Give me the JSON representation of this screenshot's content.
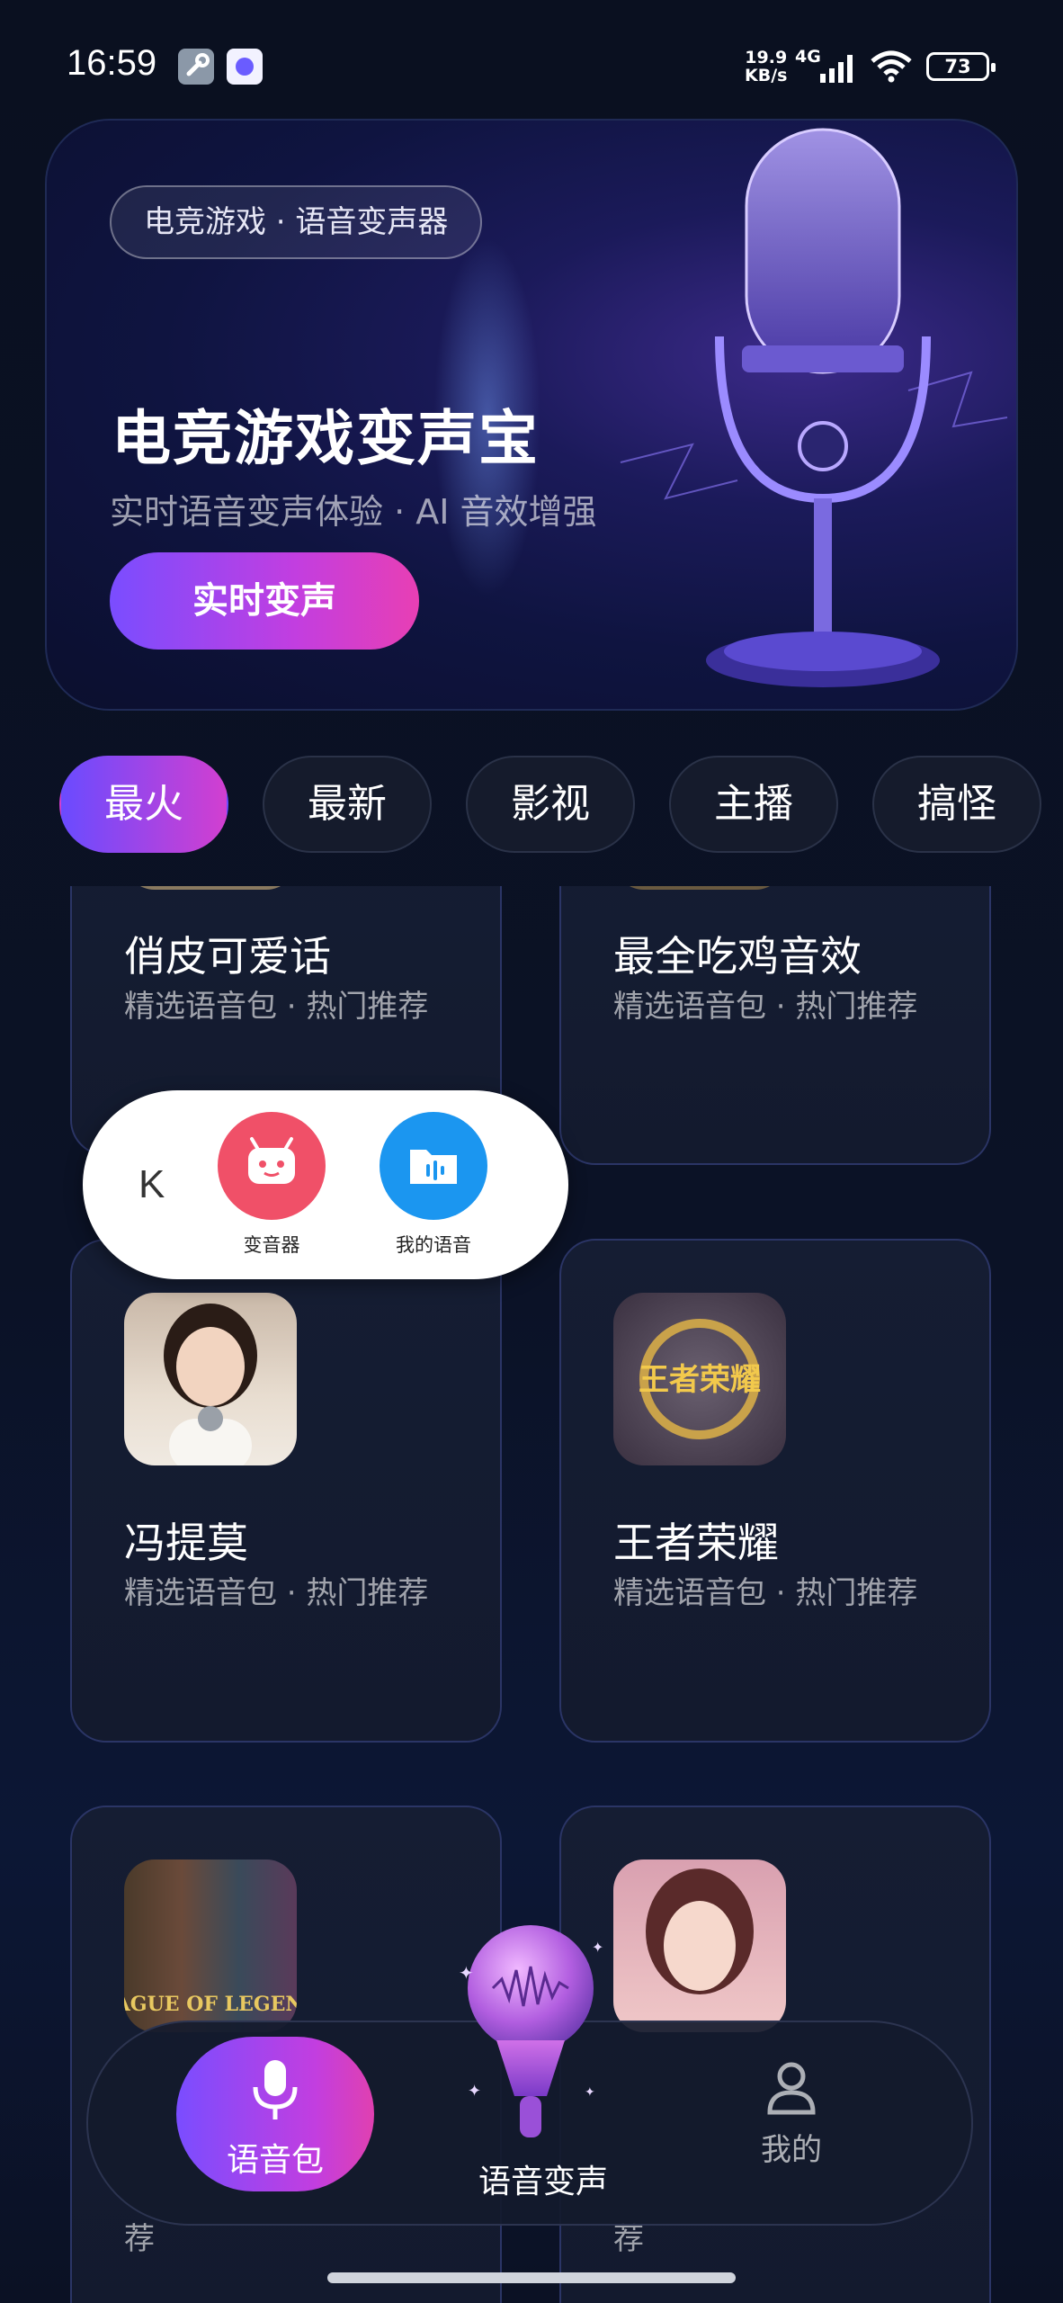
{
  "status": {
    "time": "16:59",
    "speed_value": "19.9",
    "speed_unit": "KB/s",
    "network": "4G",
    "battery": "73"
  },
  "hero": {
    "tag": "电竞游戏 · 语音变声器",
    "title": "电竞游戏变声宝",
    "subtitle": "实时语音变声体验 · AI 音效增强",
    "cta_label": "实时变声"
  },
  "tabs": [
    {
      "label": "最火",
      "active": true
    },
    {
      "label": "最新",
      "active": false
    },
    {
      "label": "影视",
      "active": false
    },
    {
      "label": "主播",
      "active": false
    },
    {
      "label": "搞怪",
      "active": false
    }
  ],
  "cards": [
    {
      "name": "俏皮可爱话",
      "desc": "精选语音包 · 热门推荐"
    },
    {
      "name": "最全吃鸡音效",
      "desc": "精选语音包 · 热门推荐"
    },
    {
      "name": "冯提莫",
      "desc": "精选语音包 · 热门推荐"
    },
    {
      "name": "王者荣耀",
      "desc": "精选语音包 · 热门推荐",
      "thumb_text": "王者荣耀"
    },
    {
      "name": "",
      "desc": "荐",
      "thumb_text": "LEAGUE OF LEGENDS"
    },
    {
      "name": "",
      "desc": "荐"
    }
  ],
  "float_assistant": {
    "collapse_icon": "K",
    "items": [
      {
        "label": "变音器",
        "icon": "robot-icon",
        "color": "#f05068"
      },
      {
        "label": "我的语音",
        "icon": "voice-folder-icon",
        "color": "#1b96f0"
      }
    ]
  },
  "bottom_nav": {
    "voice_pack_label": "语音包",
    "voice_change_label": "语音变声",
    "me_label": "我的"
  },
  "colors": {
    "accent_start": "#7a4dff",
    "accent_end": "#e83fb4",
    "background": "#0a1020",
    "card_border": "#2b3566"
  }
}
